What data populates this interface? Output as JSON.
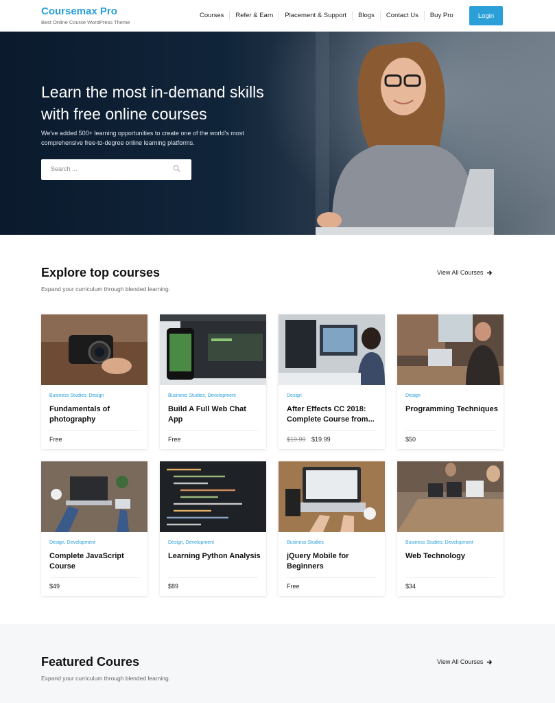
{
  "brand": {
    "name": "Coursemax Pro",
    "tagline": "Best Online Course WordPress Theme"
  },
  "nav": {
    "items": [
      "Courses",
      "Refer & Earn",
      "Placement & Support",
      "Blogs",
      "Contact Us",
      "Buy Pro"
    ],
    "login": "Login"
  },
  "hero": {
    "title": "Learn the most in-demand skills with free online courses",
    "subtitle": "We've added 500+ learning opportunities to create one of the world's most comprehensive free-to-degree online learning platforms.",
    "search_placeholder": "Search ..."
  },
  "explore": {
    "title": "Explore top courses",
    "subtitle": "Expand your curriculum through blended learning.",
    "view_all": "View All Courses",
    "courses": [
      {
        "cats": "Business Studies, Design",
        "title": "Fundamentals of photography",
        "price": "Free",
        "old_price": ""
      },
      {
        "cats": "Business Studies, Development",
        "title": "Build A Full Web Chat App",
        "price": "Free",
        "old_price": ""
      },
      {
        "cats": "Design",
        "title": "After Effects CC 2018: Complete Course from...",
        "price": "$19.99",
        "old_price": "$19.99"
      },
      {
        "cats": "Design",
        "title": "Programming Techniques",
        "price": "$50",
        "old_price": ""
      },
      {
        "cats": "Design, Development",
        "title": "Complete JavaScript Course",
        "price": "$49",
        "old_price": ""
      },
      {
        "cats": "Design, Development",
        "title": "Learning Python Analysis",
        "price": "$89",
        "old_price": ""
      },
      {
        "cats": "Business Studies",
        "title": "jQuery Mobile for Beginners",
        "price": "Free",
        "old_price": ""
      },
      {
        "cats": "Business Studies, Development",
        "title": "Web Technology",
        "price": "$34",
        "old_price": ""
      }
    ]
  },
  "featured": {
    "title": "Featured Coures",
    "subtitle": "Expand your curriculum through blended learning.",
    "view_all": "View All Courses"
  },
  "colors": {
    "accent": "#2a9fd8",
    "hero_dark": "#0b1a2d"
  }
}
